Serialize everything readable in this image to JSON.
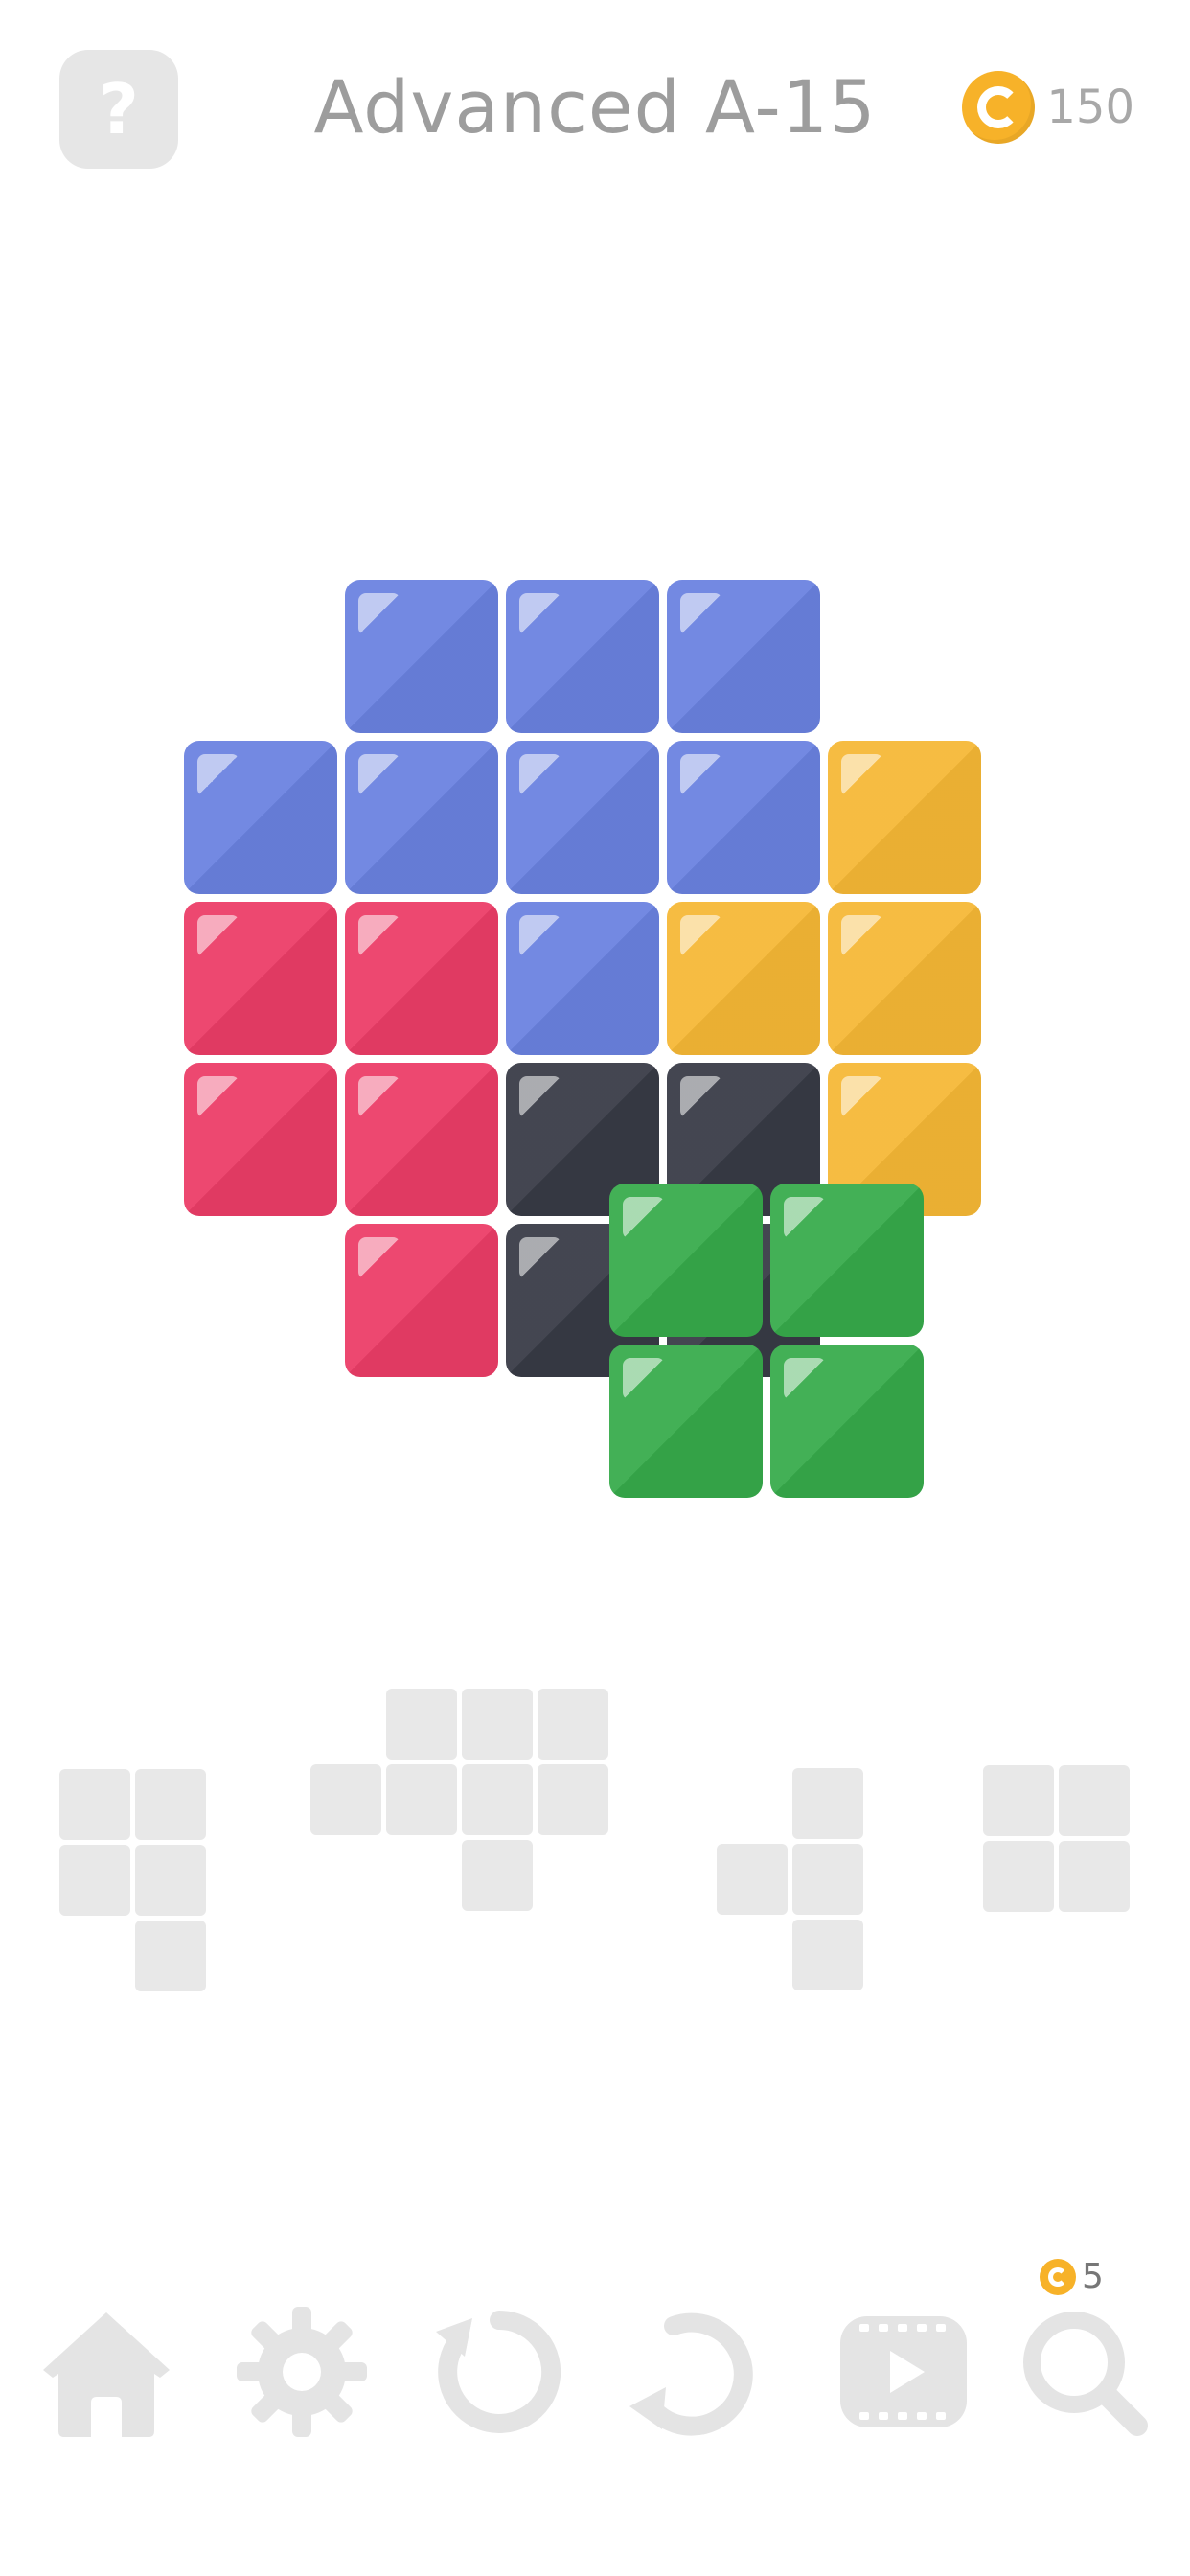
{
  "header": {
    "help_label": "?",
    "title": "Advanced A-15",
    "coins": "150"
  },
  "colors": {
    "blue": "#6a82e0",
    "yellow": "#f6b836",
    "red": "#ec3d67",
    "dark": "#383b46",
    "green": "#37ab4b",
    "coin": "#f7b229",
    "slot": "#e8e8e8"
  },
  "board": {
    "tiles": [
      {
        "color": "blue",
        "row": 0,
        "col": 1
      },
      {
        "color": "blue",
        "row": 0,
        "col": 2
      },
      {
        "color": "blue",
        "row": 0,
        "col": 3
      },
      {
        "color": "blue",
        "row": 1,
        "col": 0
      },
      {
        "color": "blue",
        "row": 1,
        "col": 1
      },
      {
        "color": "blue",
        "row": 1,
        "col": 2
      },
      {
        "color": "blue",
        "row": 1,
        "col": 3
      },
      {
        "color": "yellow",
        "row": 1,
        "col": 4
      },
      {
        "color": "red",
        "row": 2,
        "col": 0
      },
      {
        "color": "red",
        "row": 2,
        "col": 1
      },
      {
        "color": "blue",
        "row": 2,
        "col": 2
      },
      {
        "color": "yellow",
        "row": 2,
        "col": 3
      },
      {
        "color": "yellow",
        "row": 2,
        "col": 4
      },
      {
        "color": "red",
        "row": 3,
        "col": 0
      },
      {
        "color": "red",
        "row": 3,
        "col": 1
      },
      {
        "color": "dark",
        "row": 3,
        "col": 2
      },
      {
        "color": "dark",
        "row": 3,
        "col": 3
      },
      {
        "color": "yellow",
        "row": 3,
        "col": 4
      },
      {
        "color": "red",
        "row": 4,
        "col": 1
      },
      {
        "color": "dark",
        "row": 4,
        "col": 2
      },
      {
        "color": "dark",
        "row": 4,
        "col": 3
      }
    ],
    "dragging_piece": {
      "color": "green",
      "cells": [
        [
          0,
          0
        ],
        [
          0,
          1
        ],
        [
          1,
          0
        ],
        [
          1,
          1
        ]
      ]
    }
  },
  "tray": {
    "pieces": [
      {
        "name": "piece-1",
        "cells": [
          [
            0,
            0
          ],
          [
            0,
            1
          ],
          [
            1,
            0
          ],
          [
            1,
            1
          ],
          [
            2,
            1
          ]
        ]
      },
      {
        "name": "piece-2",
        "cells": [
          [
            0,
            1
          ],
          [
            0,
            2
          ],
          [
            0,
            3
          ],
          [
            1,
            0
          ],
          [
            1,
            1
          ],
          [
            1,
            2
          ],
          [
            1,
            3
          ],
          [
            2,
            2
          ]
        ]
      },
      {
        "name": "piece-3",
        "cells": [
          [
            0,
            1
          ],
          [
            1,
            0
          ],
          [
            1,
            1
          ],
          [
            2,
            1
          ]
        ]
      },
      {
        "name": "piece-4",
        "cells": [
          [
            0,
            0
          ],
          [
            0,
            1
          ],
          [
            1,
            0
          ],
          [
            1,
            1
          ]
        ]
      }
    ]
  },
  "toolbar": {
    "items": [
      {
        "name": "home-button",
        "icon": "home-icon"
      },
      {
        "name": "settings-button",
        "icon": "gear-icon"
      },
      {
        "name": "restart-button",
        "icon": "restart-icon"
      },
      {
        "name": "undo-button",
        "icon": "undo-icon"
      },
      {
        "name": "video-button",
        "icon": "video-icon"
      },
      {
        "name": "hint-button",
        "icon": "search-icon"
      }
    ],
    "hint_cost": "5"
  }
}
